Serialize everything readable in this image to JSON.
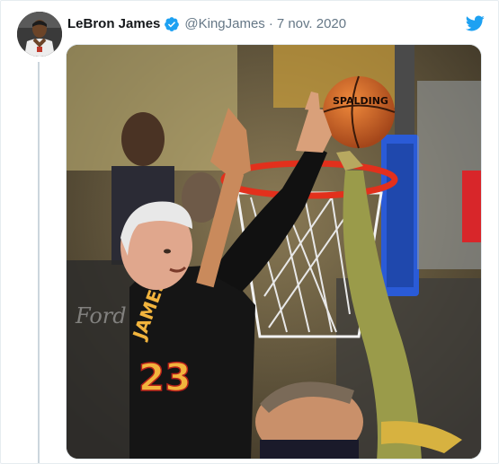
{
  "author": {
    "display_name": "LeBron James",
    "handle": "@KingJames",
    "verified": true,
    "avatar_icon": "user-avatar-photo"
  },
  "tweet": {
    "separator": "·",
    "date": "7 nov. 2020"
  },
  "media": {
    "alt_icon": "basketball-block-photo",
    "ball_brand": "SPALDING",
    "jersey_name": "JAMES",
    "jersey_number": "23",
    "court_text": "Ford"
  },
  "colors": {
    "twitter_blue": "#1da1f2",
    "verified_blue": "#1da1f2",
    "name": "#14171a",
    "secondary": "#657786",
    "rim": "#e2301c",
    "jersey_gold": "#f2b43d",
    "backboard_blue": "#2a5bd7"
  }
}
